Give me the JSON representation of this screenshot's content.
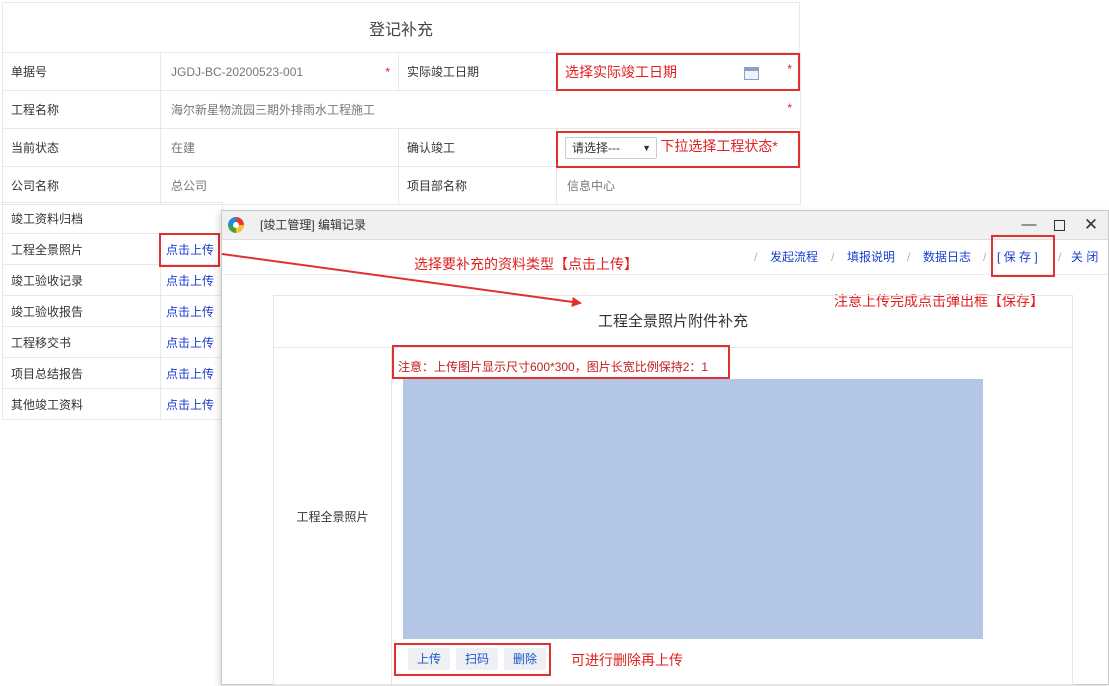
{
  "form": {
    "title": "登记补充",
    "rows": {
      "doc_no_label": "单据号",
      "doc_no_value": "JGDJ-BC-20200523-001",
      "actual_date_label": "实际竣工日期",
      "project_name_label": "工程名称",
      "project_name_value": "海尔新星物流园三期外排雨水工程施工",
      "status_label": "当前状态",
      "status_value": "在建",
      "confirm_label": "确认竣工",
      "confirm_select": "请选择---",
      "company_label": "公司名称",
      "company_value": "总公司",
      "dept_label": "项目部名称",
      "dept_value": "信息中心",
      "archive_label": "竣工资料归档"
    },
    "required_mark": "*"
  },
  "attachments": [
    {
      "label": "工程全景照片",
      "action": "点击上传"
    },
    {
      "label": "竣工验收记录",
      "action": "点击上传"
    },
    {
      "label": "竣工验收报告",
      "action": "点击上传"
    },
    {
      "label": "工程移交书",
      "action": "点击上传"
    },
    {
      "label": "项目总结报告",
      "action": "点击上传"
    },
    {
      "label": "其他竣工资料",
      "action": "点击上传"
    }
  ],
  "annotations": {
    "select_date": "选择实际竣工日期",
    "select_status": "下拉选择工程状态*",
    "choose_type": "选择要补充的资料类型【点击上传】",
    "save_hint": "注意上传完成点击弹出框【保存】",
    "delete_hint": "可进行删除再上传"
  },
  "popup": {
    "title": "[竣工管理] 编辑记录",
    "win_min": "—",
    "win_close": "✕",
    "toolbar": {
      "start_flow": "发起流程",
      "fill_help": "填报说明",
      "data_log": "数据日志",
      "save": "[ 保 存 ]",
      "close": "关 闭",
      "separator": "/"
    },
    "panel_title": "工程全景照片附件补充",
    "field_label": "工程全景照片",
    "note": "注意：上传图片显示尺寸600*300，图片长宽比例保持2：1",
    "buttons": {
      "upload": "上传",
      "scan": "扫码",
      "delete": "删除"
    }
  },
  "colors": {
    "accent_red": "#e03030",
    "link_blue": "#1a3dcc",
    "photo_placeholder": "#b4c6e6"
  },
  "icons": [
    "calendar-icon",
    "app-logo-icon",
    "minimize-icon",
    "maximize-icon",
    "close-icon",
    "dropdown-caret-icon"
  ]
}
